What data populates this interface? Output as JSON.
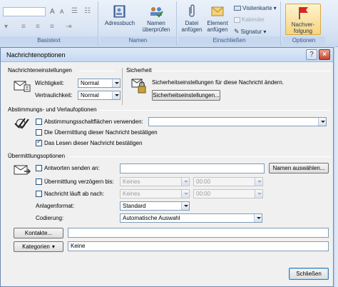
{
  "ribbon": {
    "groups": [
      {
        "label": "Basistext"
      },
      {
        "label": "Namen"
      },
      {
        "label": "Einschließen"
      },
      {
        "label": "Optionen"
      }
    ],
    "buttons": {
      "adressbuch": "Adressbuch",
      "namen_1": "Namen",
      "namen_2": "überprüfen",
      "datei_1": "Datei",
      "datei_2": "anfügen",
      "element_1": "Element",
      "element_2": "anfügen",
      "visitenkarte": "Visitenkarte",
      "kalender": "Kalender",
      "signatur": "Signatur",
      "nachverfolgung_1": "Nachver-",
      "nachverfolgung_2": "folgung"
    }
  },
  "dialog": {
    "title": "Nachrichtenoptionen",
    "settings": {
      "title": "Nachrichteneinstellungen",
      "importance_label": "Wichtigkeit:",
      "importance_value": "Normal",
      "sensitivity_label": "Vertraulichkeit:",
      "sensitivity_value": "Normal"
    },
    "security": {
      "title": "Sicherheit",
      "description": "Sicherheitseinstellungen für diese Nachricht ändern.",
      "button": "Sicherheitseinstellungen..."
    },
    "voting": {
      "title": "Abstimmungs- und Verlaufoptionen",
      "voting_buttons": "Abstimmungsschaltflächen verwenden:",
      "delivery_receipt": "Die Übermittlung dieser Nachricht bestätigen",
      "read_receipt": "Das Lesen dieser Nachricht bestätigen",
      "read_receipt_checked": true
    },
    "delivery": {
      "title": "Übermittlungsoptionen",
      "replies_to": "Antworten senden an:",
      "select_names": "Namen auswählen...",
      "delay_delivery": "Übermittlung verzögern bis:",
      "delay_date": "Keines",
      "delay_time": "00:00",
      "expires": "Nachricht läuft ab nach:",
      "expires_date": "Keines",
      "expires_time": "00:00",
      "attachment_format_label": "Anlagenformat:",
      "attachment_format_value": "Standard",
      "encoding_label": "Codierung:",
      "encoding_value": "Automatische Auswahl"
    },
    "contacts_button": "Kontakte...",
    "categories_button": "Kategorien",
    "categories_value": "Keine",
    "close_button": "Schließen"
  }
}
